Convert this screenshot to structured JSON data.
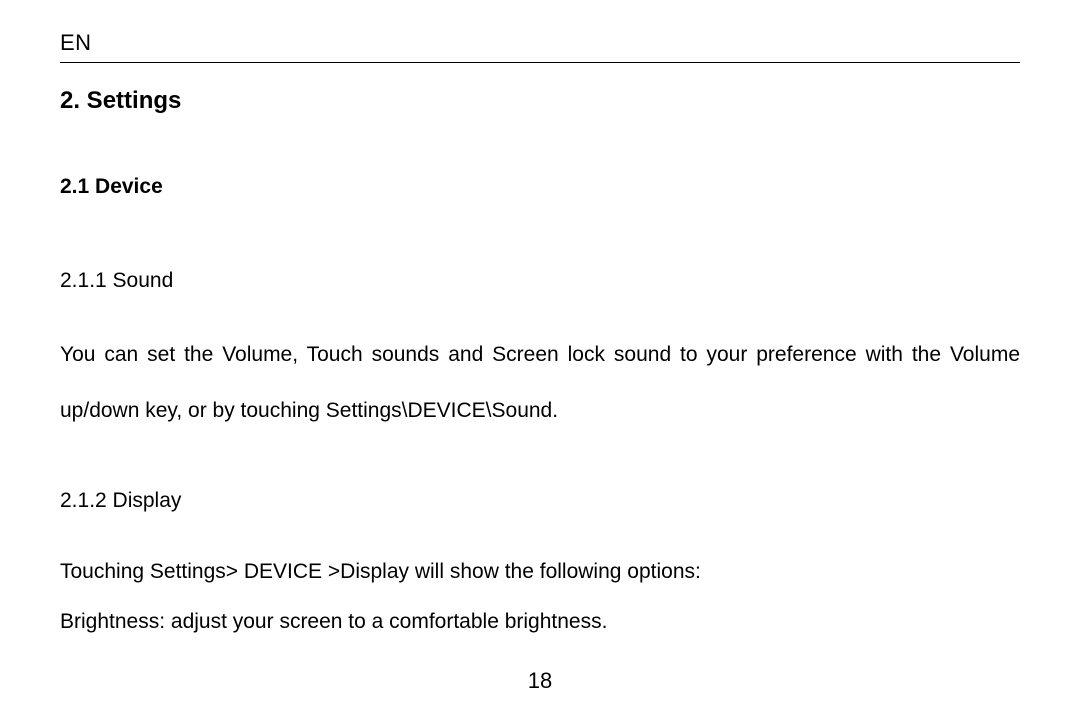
{
  "header": {
    "language": "EN"
  },
  "section": {
    "title": "2. Settings",
    "subsection": {
      "title": "2.1 Device",
      "items": [
        {
          "heading": "2.1.1 Sound",
          "body": "You can set the Volume, Touch sounds and Screen lock sound to your preference with the Volume up/down key, or by touching Settings\\DEVICE\\Sound."
        },
        {
          "heading": "2.1.2 Display",
          "intro": "Touching Settings> DEVICE >Display will show the following options:",
          "option": "Brightness: adjust your screen to a comfortable brightness."
        }
      ]
    }
  },
  "page_number": "18"
}
